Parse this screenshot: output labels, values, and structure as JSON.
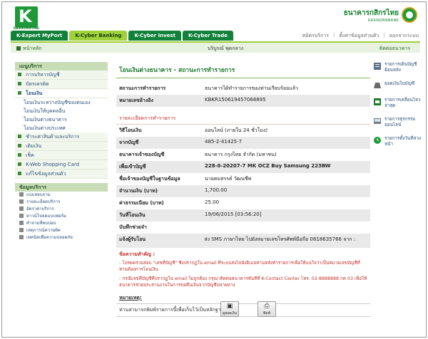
{
  "header": {
    "logo_letter": "K",
    "logo_caption": "KASIKORNTHAI",
    "bank_name_th": "ธนาคารกสิกรไทย",
    "bank_name_en": "KASIKORNBANK",
    "tabs": [
      "K-Expert MyPort",
      "K-Cyber Banking",
      "K-Cyber Invest",
      "K-Cyber Trade"
    ],
    "active_tab": 1,
    "top_links": [
      "สมัครบริการ",
      "ตั้งค่าข้อมูลส่วนตัว",
      "ออกจากระบบ"
    ]
  },
  "subbar": {
    "home": "หน้าหลัก",
    "user": "บริบูรณ์ พุดกลาง",
    "contact": "ติดต่อธนาคาร"
  },
  "sidebar": {
    "title": "เมนูบริการ",
    "items": [
      {
        "label": "การบริหารบัญชี"
      },
      {
        "label": "บัตรเครดิต"
      },
      {
        "label": "โอนเงิน"
      }
    ],
    "sub_items": [
      "โอนเงินระหว่างบัญชีของตนเอง",
      "โอนเงินให้บุคคลอื่น",
      "โอนเงินต่างธนาคาร",
      "โอนเงินต่างประเทศ"
    ],
    "items2": [
      {
        "label": "ชำระค่าสินค้าและบริการ"
      },
      {
        "label": "เติมเงิน"
      },
      {
        "label": "เช็ค"
      },
      {
        "label": "K-Web Shopping Card"
      },
      {
        "label": "แก้ไขข้อมูลส่วนตัว"
      }
    ],
    "info_title": "ข้อมูลบริการ",
    "info_items": [
      "แบบสอบถาม",
      "รายละเอียดบริการ",
      "อัตราค่าบริการ",
      "ดาวน์โหลดแบบฟอร์ม",
      "คำถามที่พบบ่อย",
      "เหตุการณ์ความผิด",
      "เทคนิคเพื่อความปลอดภัย"
    ]
  },
  "main": {
    "title": "โอนเงินต่างธนาคาร - สถานะการทำรายการ",
    "status_label": "สถานะการทำรายการ",
    "status_value": "ธนาคารได้ทำรายการของท่านเรียบร้อยแล้ว",
    "ref_label": "หมายเลขอ้างอิง",
    "ref_value": "KBKR150619457068895",
    "section_title": "รายละเอียดการทำรายการ",
    "rows": [
      {
        "k": "วิธีโอนเงิน",
        "v": "ออนไลน์ (ภายใน 24 ชั่วโมง)"
      },
      {
        "k": "จากบัญชี",
        "v": "485-2-41425-7"
      },
      {
        "k": "ธนาคารเจ้าของบัญชี",
        "v": "ธนาคาร กรุงไทย จำกัด (มหาชน)"
      },
      {
        "k": "เพื่อเข้าบัญชี",
        "v": "228-0-20207-7 MK OCZ Buy Samsung 223BW"
      },
      {
        "k": "ชื่อเจ้าของบัญชีในฐานข้อมูล",
        "v": "นายคมสรรค์ วัฒนชีพ"
      },
      {
        "k": "จำนวนเงิน (บาท)",
        "v": "1,700.00"
      },
      {
        "k": "ค่าธรรมเนียม (บาท)",
        "v": "25.00"
      },
      {
        "k": "วันที่โอนเงิน",
        "v": "19/06/2015 [03:56:20]"
      },
      {
        "k": "บันทึกช่วยจำ",
        "v": ""
      },
      {
        "k": "แจ้งผู้รับโอน",
        "v": "ส่ง SMS ภาษาไทย ไปยังหมายเลขโทรศัพท์มือถือ 0818635766 จาก :"
      }
    ],
    "note_title": "ข้อความสำคัญ :",
    "notes": [
      "- โปรดตรวจสอบ \"เลขที่บัญชี\" ซึ่งปรากฏใน email ที่ระบบส่งไปยังอีเมลท่านหลังทำรายการเพื่อให้แน่ใจว่าเป็นหมายเลขบัญชีที่ท่านต้องการโอนเงิน",
      "- กรณีเลขที่บัญชีที่ปรากฏใน email ไม่ถูกต้อง กรุณาติดต่อธนาคารทันทีที่ K-Contact Center โทร. 02-8888888 กด 03 เพื่อให้ธนาคารช่วยประสานงานในการขอคืนเงินจากบัญชีปลายทาง"
    ],
    "remarks_title": "หมายเหตุ:",
    "remarks": "ท่านสามารถพิมพ์รายการนี้เพื่อเก็บไว้เป็นหลักฐาน",
    "btn_save": "ดูยอดเงิน",
    "btn_print": "พิมพ์"
  },
  "rightcol": [
    {
      "label": "รายการเดินบัญชีย้อนหลัง",
      "icon": "statement-icon",
      "color": "#5a6f8a"
    },
    {
      "label": "ยอดเงินในบัญชี",
      "icon": "balance-icon",
      "color": "#6a6a6a"
    },
    {
      "label": "รายการเคลื่อนไหวล่าสุด",
      "icon": "activity-icon",
      "color": "#1e7a30"
    },
    {
      "label": "รายการธุรกรรมออนไลน์",
      "icon": "transaction-icon",
      "color": "#7a7a7a"
    },
    {
      "label": "รายการตั้งวันที่ล่วงหน้า",
      "icon": "schedule-icon",
      "color": "#1e9a3a"
    }
  ],
  "colors": {
    "brand": "#1e9a3a",
    "accent": "#9ed13a",
    "alert": "#c0302a"
  }
}
